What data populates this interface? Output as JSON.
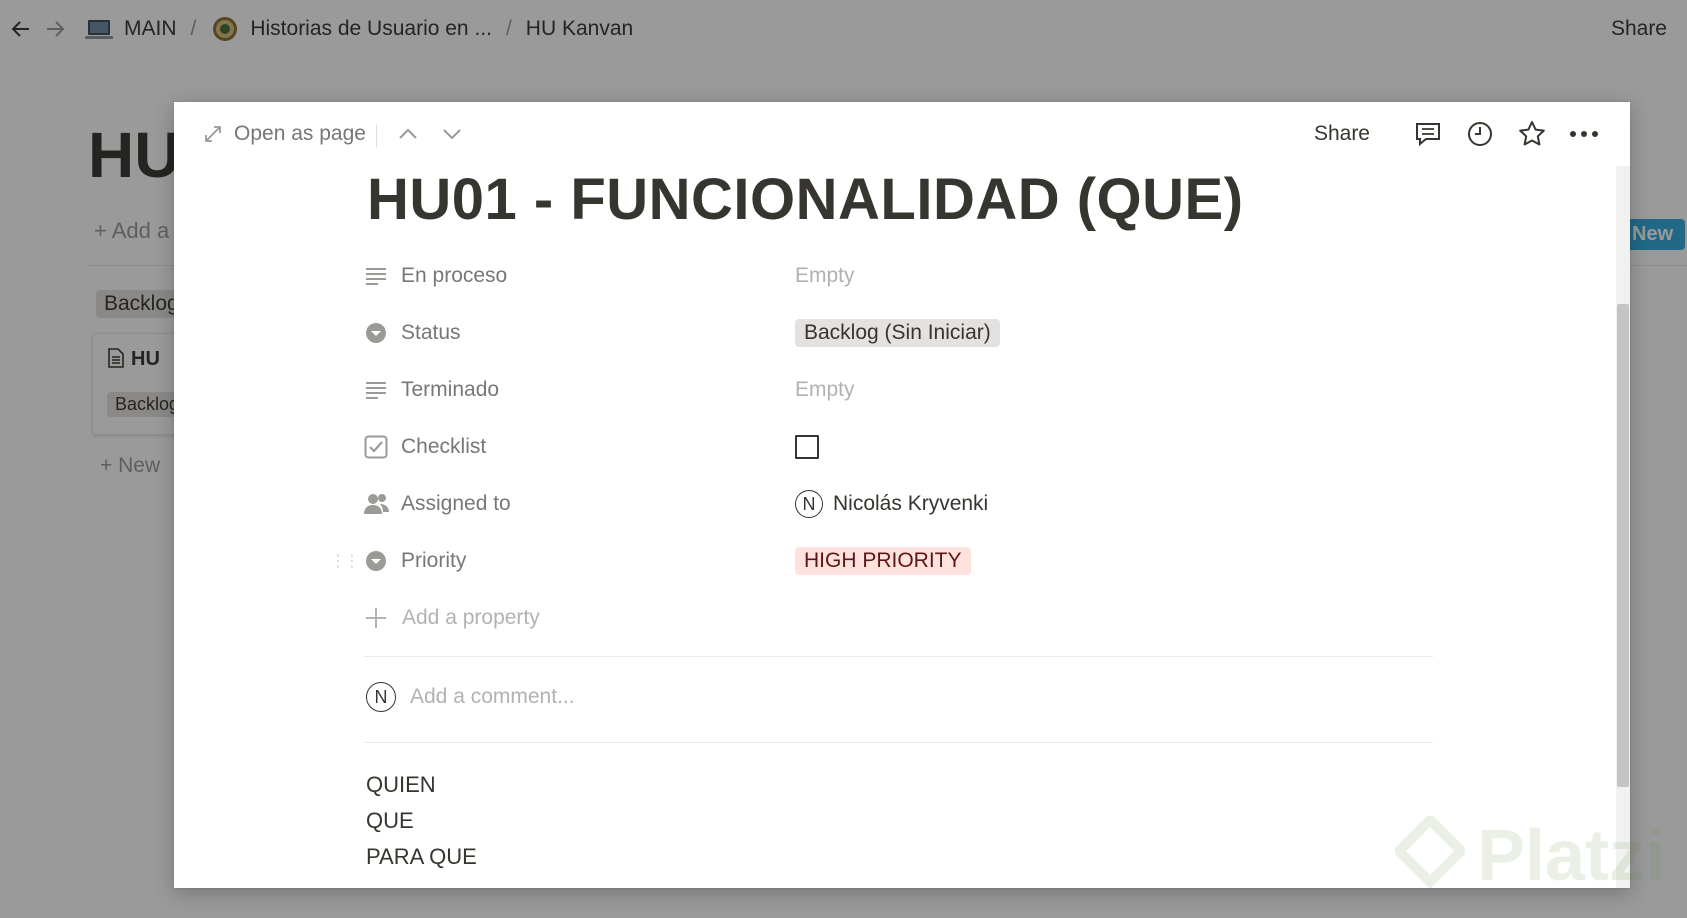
{
  "topbar": {
    "breadcrumbs": [
      {
        "label": "MAIN",
        "icon": "laptop-icon"
      },
      {
        "label": "Historias de Usuario en ...",
        "icon": "seal-icon"
      },
      {
        "label": "HU Kanvan"
      }
    ],
    "separator": "/",
    "share_label": "Share"
  },
  "background_page": {
    "title": "HU",
    "add_label": "Add a",
    "group_tag": "Backlog",
    "card_title": "HU",
    "card_tag": "Backlog",
    "new_left": "New",
    "new_right": "New"
  },
  "modal": {
    "open_as_page": "Open as page",
    "share_label": "Share",
    "title": "HU01 - FUNCIONALIDAD (QUE)",
    "properties": [
      {
        "icon": "text-lines-icon",
        "label": "En proceso",
        "value": "Empty",
        "type": "empty"
      },
      {
        "icon": "select-icon",
        "label": "Status",
        "value": "Backlog (Sin Iniciar)",
        "type": "tag",
        "color": "#e3e2e0"
      },
      {
        "icon": "text-lines-icon",
        "label": "Terminado",
        "value": "Empty",
        "type": "empty"
      },
      {
        "icon": "checkbox-icon",
        "label": "Checklist",
        "value": "",
        "type": "checkbox",
        "checked": false
      },
      {
        "icon": "people-icon",
        "label": "Assigned to",
        "value": "Nicolás Kryvenki",
        "type": "person",
        "avatar_initial": "N"
      },
      {
        "icon": "select-icon",
        "label": "Priority",
        "value": "HIGH PRIORITY",
        "type": "tag",
        "color": "#ffe2dd"
      }
    ],
    "add_property_label": "Add a property",
    "comment": {
      "avatar_initial": "N",
      "placeholder": "Add a comment..."
    },
    "body_lines": [
      "QUIEN",
      "QUE",
      "PARA QUE"
    ]
  },
  "watermark": {
    "text": "Platzi"
  }
}
